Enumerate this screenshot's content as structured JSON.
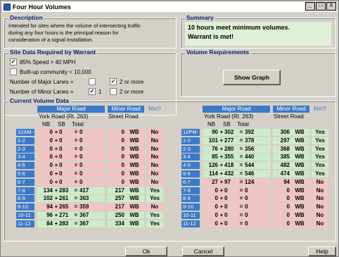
{
  "window": {
    "title": "Four Hour Volumes",
    "min": "_",
    "max": "□",
    "close": "X"
  },
  "description": {
    "label": "Description",
    "text_line1": "Intended for sites where the volume of intersecting traffic",
    "text_line2": "during any four hours is the principal reason for",
    "text_line3": "consideration of a signal installation."
  },
  "site": {
    "label": "Site Data Required by Warrant",
    "speed_label": "85% Speed > 40 MPH",
    "speed_checked": "✓",
    "builtup_label": "Built-up community < 10,000",
    "builtup_checked": "",
    "major_lanes_label": "Number of Major Lanes =",
    "major_1": "",
    "major_2": "✓",
    "major_2_label": "2 or more",
    "minor_lanes_label": "Number of Minor Lanes =",
    "minor_1": "✓",
    "minor_1_label": "1",
    "minor_2": "",
    "minor_2_label": "2 or more"
  },
  "summary": {
    "label": "Summary",
    "line1": "10 hours meet minimum volumes.",
    "line2": "Warrant is met!"
  },
  "requirements": {
    "label": "Volume Requirements",
    "show_graph": "Show Graph"
  },
  "current": {
    "label": "Current Volume Data",
    "major": "Major Road",
    "minor": "Minor Road",
    "met": "Met?",
    "major_name": "York Road (Rt. 263)",
    "minor_name": "Street Road",
    "nb": "NB",
    "sb": "SB",
    "total": "Total"
  },
  "left_rows": [
    {
      "hour": "12AM-1",
      "nb": "0",
      "sb": "0",
      "total": "0",
      "minor": "0",
      "dir": "WB",
      "met": "No"
    },
    {
      "hour": "1-2",
      "nb": "0",
      "sb": "0",
      "total": "0",
      "minor": "0",
      "dir": "WB",
      "met": "No"
    },
    {
      "hour": "2-3",
      "nb": "0",
      "sb": "0",
      "total": "0",
      "minor": "0",
      "dir": "WB",
      "met": "No"
    },
    {
      "hour": "3-4",
      "nb": "0",
      "sb": "0",
      "total": "0",
      "minor": "0",
      "dir": "WB",
      "met": "No"
    },
    {
      "hour": "4-5",
      "nb": "0",
      "sb": "0",
      "total": "0",
      "minor": "0",
      "dir": "WB",
      "met": "No"
    },
    {
      "hour": "5-6",
      "nb": "0",
      "sb": "0",
      "total": "0",
      "minor": "0",
      "dir": "WB",
      "met": "No"
    },
    {
      "hour": "6-7",
      "nb": "0",
      "sb": "0",
      "total": "0",
      "minor": "0",
      "dir": "WB",
      "met": "No"
    },
    {
      "hour": "7-8",
      "nb": "134",
      "sb": "283",
      "total": "417",
      "minor": "217",
      "dir": "WB",
      "met": "Yes"
    },
    {
      "hour": "8-9",
      "nb": "102",
      "sb": "261",
      "total": "363",
      "minor": "257",
      "dir": "WB",
      "met": "Yes"
    },
    {
      "hour": "9-10",
      "nb": "94",
      "sb": "265",
      "total": "359",
      "minor": "217",
      "dir": "WB",
      "met": "No"
    },
    {
      "hour": "10-11",
      "nb": "96",
      "sb": "271",
      "total": "367",
      "minor": "250",
      "dir": "WB",
      "met": "Yes"
    },
    {
      "hour": "11-12",
      "nb": "84",
      "sb": "283",
      "total": "367",
      "minor": "334",
      "dir": "WB",
      "met": "Yes"
    }
  ],
  "right_rows": [
    {
      "hour": "12PM-1",
      "nb": "90",
      "sb": "302",
      "total": "392",
      "minor": "306",
      "dir": "WB",
      "met": "Yes"
    },
    {
      "hour": "1-2",
      "nb": "101",
      "sb": "277",
      "total": "378",
      "minor": "297",
      "dir": "WB",
      "met": "Yes"
    },
    {
      "hour": "2-3",
      "nb": "76",
      "sb": "280",
      "total": "356",
      "minor": "368",
      "dir": "WB",
      "met": "Yes"
    },
    {
      "hour": "3-4",
      "nb": "85",
      "sb": "355",
      "total": "440",
      "minor": "385",
      "dir": "WB",
      "met": "Yes"
    },
    {
      "hour": "4-5",
      "nb": "126",
      "sb": "418",
      "total": "544",
      "minor": "482",
      "dir": "WB",
      "met": "Yes"
    },
    {
      "hour": "5-6",
      "nb": "114",
      "sb": "432",
      "total": "546",
      "minor": "474",
      "dir": "WB",
      "met": "Yes"
    },
    {
      "hour": "6-7",
      "nb": "27",
      "sb": "97",
      "total": "124",
      "minor": "94",
      "dir": "WB",
      "met": "No"
    },
    {
      "hour": "7-8",
      "nb": "0",
      "sb": "0",
      "total": "0",
      "minor": "0",
      "dir": "WB",
      "met": "No"
    },
    {
      "hour": "8-9",
      "nb": "0",
      "sb": "0",
      "total": "0",
      "minor": "0",
      "dir": "WB",
      "met": "No"
    },
    {
      "hour": "9-10",
      "nb": "0",
      "sb": "0",
      "total": "0",
      "minor": "0",
      "dir": "WB",
      "met": "No"
    },
    {
      "hour": "10-11",
      "nb": "0",
      "sb": "0",
      "total": "0",
      "minor": "0",
      "dir": "WB",
      "met": "No"
    },
    {
      "hour": "11-12",
      "nb": "0",
      "sb": "0",
      "total": "0",
      "minor": "0",
      "dir": "WB",
      "met": "No"
    }
  ],
  "buttons": {
    "ok": "Ok",
    "cancel": "Cancel",
    "help": "Help"
  }
}
